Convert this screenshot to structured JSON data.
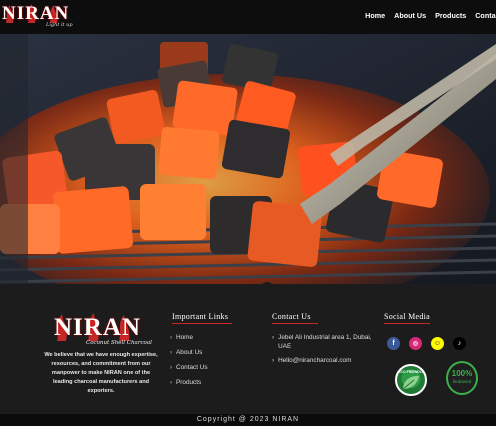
{
  "header": {
    "logo_text": "NIRAN",
    "logo_tagline": "Light it up",
    "nav": [
      "Home",
      "About Us",
      "Products",
      "Contact"
    ]
  },
  "footer": {
    "logo_text": "NIRAN",
    "logo_tagline": "Coconut Shell Charcoal",
    "about": "We believe that we have enough expertise, resources, and commitment from our manpower to make NIRAN one of the leading charcoal manufacturers and exporters.",
    "important_links_title": "Important Links",
    "links": [
      "Home",
      "About Us",
      "Contact Us",
      "Products"
    ],
    "contact_title": "Contact Us",
    "address": "Jebel Ali Industrial area 1, Dubai, UAE",
    "email": "Hello@nirancharcoal.com",
    "social_title": "Social Media",
    "social_icons": [
      "facebook-icon",
      "instagram-icon",
      "snapchat-icon",
      "tiktok-icon"
    ],
    "badges": {
      "eco_text": "ECO FRIENDLY",
      "bio_percent": "100%",
      "bio_label": "biobased"
    },
    "copyright": "Copyright @ 2023 NIRAN"
  },
  "colors": {
    "accent_red": "#c62828",
    "facebook": "#3b5998",
    "instagram": "#d62976",
    "snapchat": "#fffc00",
    "tiktok": "#000000",
    "eco_green": "#2e9b47"
  }
}
